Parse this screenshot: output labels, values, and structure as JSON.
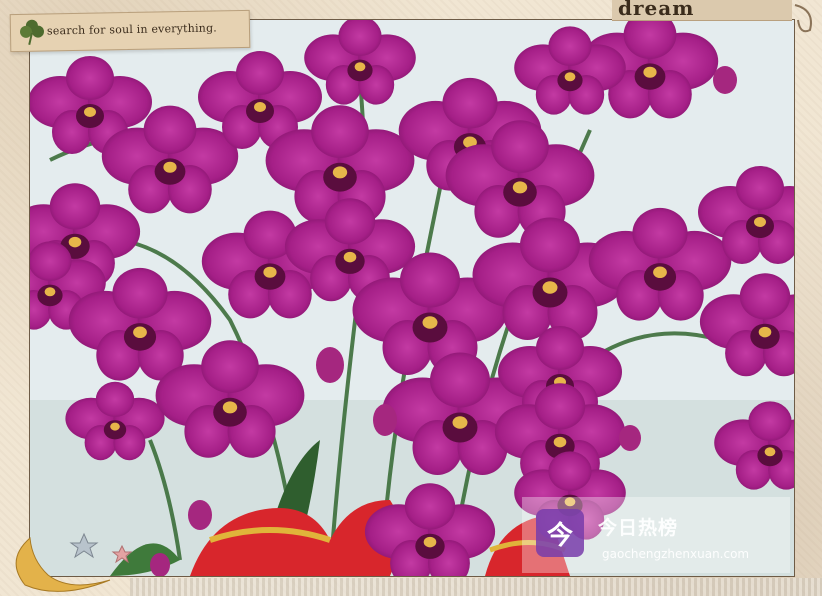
{
  "banner": {
    "text": "search for soul in everything."
  },
  "corner_tag": {
    "text": "dream"
  },
  "watermark": {
    "logo_glyph": "今",
    "title": "今日热榜",
    "url": "gaochengzhenxuan.com"
  },
  "colors": {
    "petal": "#b0228e",
    "petal_dark": "#7d136a",
    "lip": "#5a0d3e",
    "ribbon": "#d8262c",
    "gold": "#e0b43a",
    "leaf": "#3c6e3a"
  },
  "icons": [
    "clover-icon",
    "moon-icon",
    "star-icon",
    "logo-icon"
  ]
}
